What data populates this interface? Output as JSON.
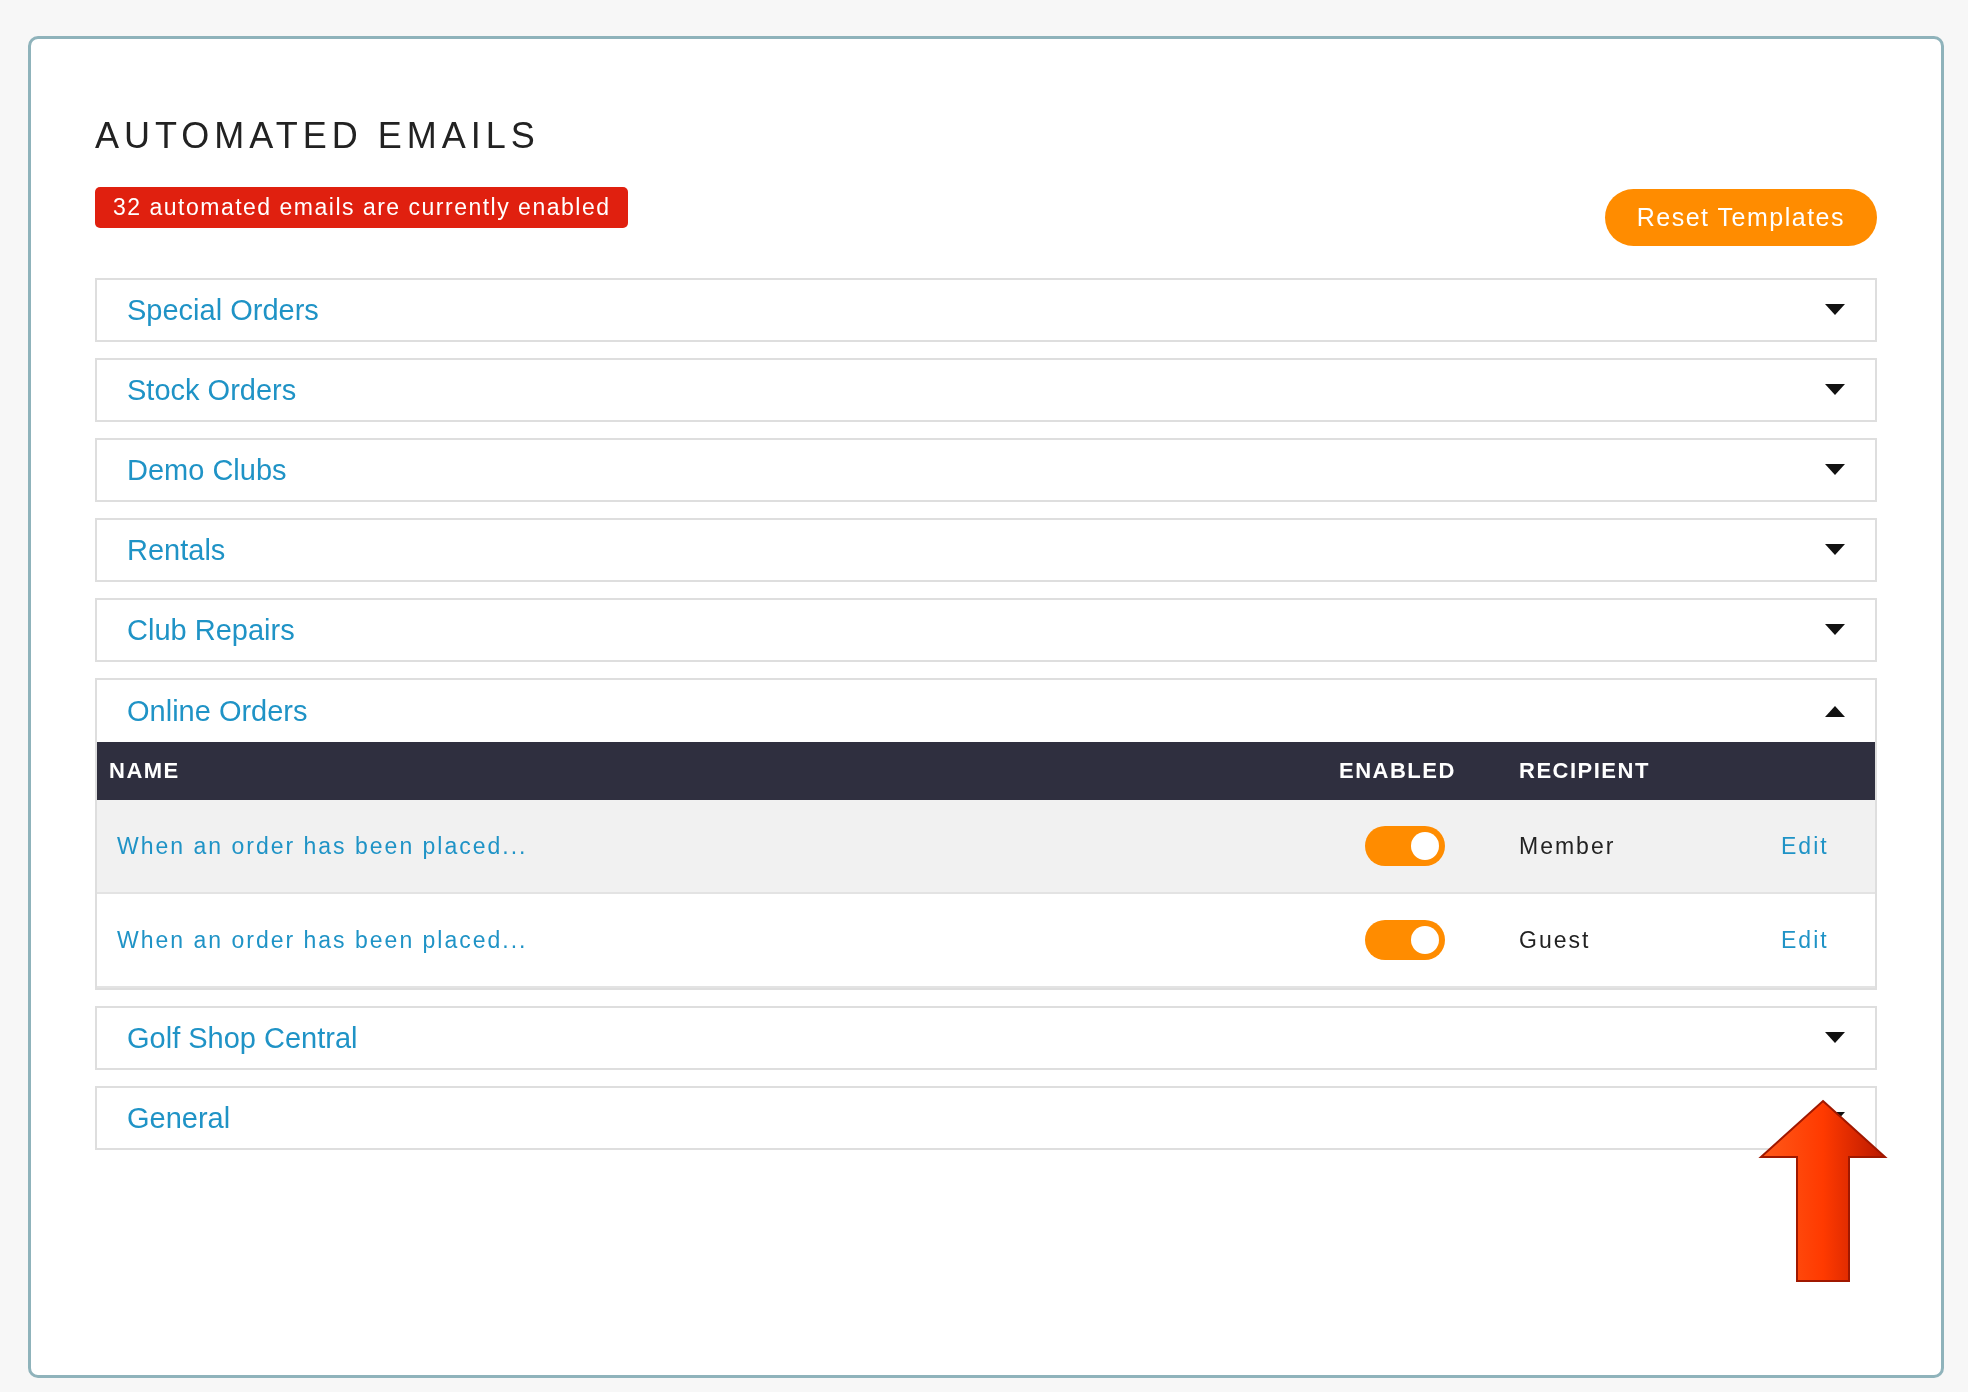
{
  "title": "AUTOMATED EMAILS",
  "status_badge": "32 automated emails are currently enabled",
  "reset_button": "Reset Templates",
  "sections": [
    {
      "title": "Special Orders",
      "expanded": false
    },
    {
      "title": "Stock Orders",
      "expanded": false
    },
    {
      "title": "Demo Clubs",
      "expanded": false
    },
    {
      "title": "Rentals",
      "expanded": false
    },
    {
      "title": "Club Repairs",
      "expanded": false
    },
    {
      "title": "Online Orders",
      "expanded": true,
      "table": {
        "columns": [
          "NAME",
          "ENABLED",
          "RECIPIENT"
        ],
        "rows": [
          {
            "name": "When an order has been placed...",
            "enabled": true,
            "recipient": "Member",
            "action": "Edit",
            "selected": true
          },
          {
            "name": "When an order has been placed...",
            "enabled": true,
            "recipient": "Guest",
            "action": "Edit",
            "selected": false
          }
        ]
      }
    },
    {
      "title": "Golf Shop Central",
      "expanded": false
    },
    {
      "title": "General",
      "expanded": false
    }
  ]
}
